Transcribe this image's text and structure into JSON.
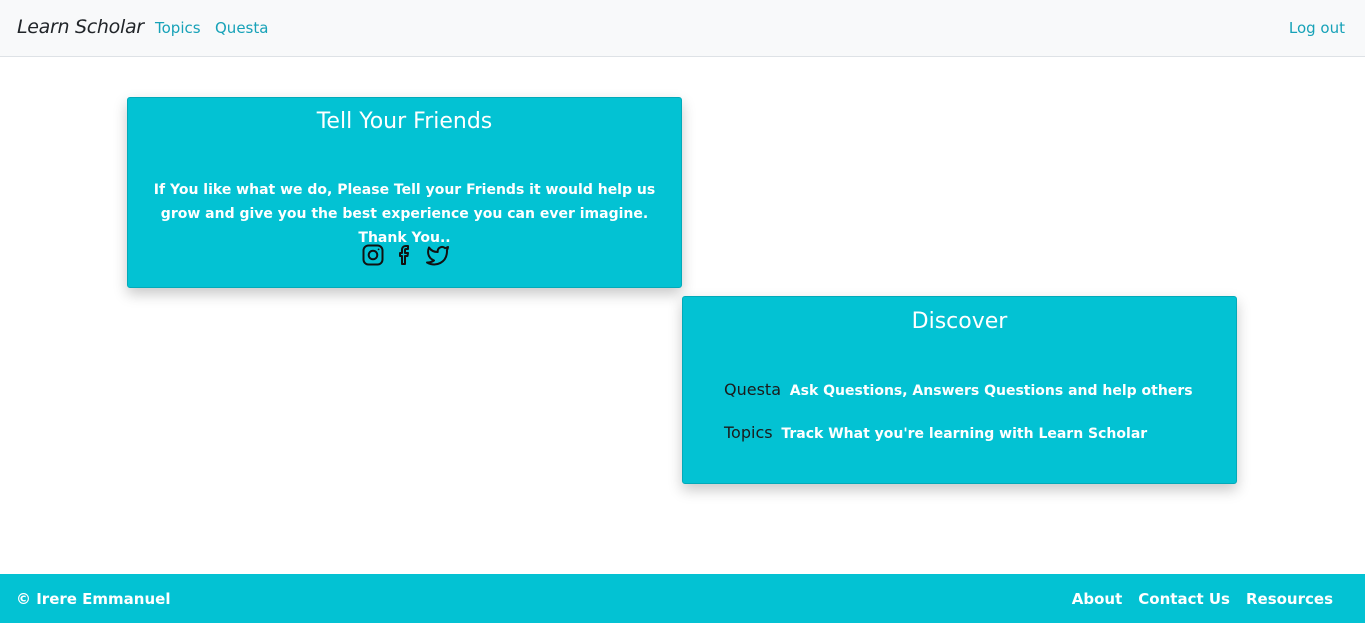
{
  "navbar": {
    "brand": "Learn Scholar",
    "links": [
      "Topics",
      "Questa"
    ],
    "logout": "Log out"
  },
  "friends_card": {
    "title": "Tell Your Friends",
    "text": "If You like what we do, Please Tell your Friends it would help us grow and give you the best experience you can ever imagine. Thank You..",
    "icons": [
      "instagram-icon",
      "facebook-icon",
      "twitter-icon"
    ]
  },
  "discover_card": {
    "title": "Discover",
    "items": [
      {
        "key": "Questa",
        "desc": "Ask Questions, Answers Questions and help others"
      },
      {
        "key": "Topics",
        "desc": "Track What you're learning with Learn Scholar"
      }
    ]
  },
  "footer": {
    "copyright": "© Irere Emmanuel",
    "links": [
      "About",
      "Contact Us",
      "Resources"
    ]
  },
  "colors": {
    "accent": "#03c2d3",
    "link": "#17a2b8",
    "navbar_bg": "#f8f9fa"
  }
}
